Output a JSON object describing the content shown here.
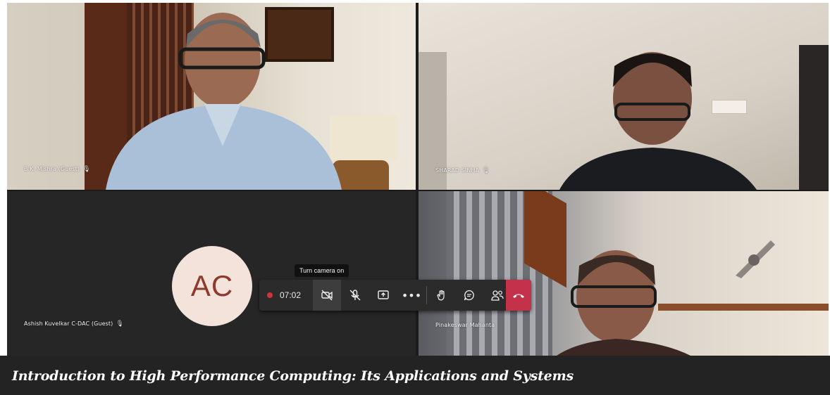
{
  "participants": [
    {
      "name": "B.K. Mishra (Guest)"
    },
    {
      "name": "SHARAD SINHA"
    },
    {
      "name": "Ashish Kuvelkar C-DAC (Guest)",
      "initials": "AC"
    },
    {
      "name": "Pinakeswar Mahanta"
    }
  ],
  "toolbar": {
    "timer": "07:02",
    "tooltip": "Turn camera on",
    "recording_color": "#d13438",
    "hangup_color": "#c4314b",
    "icons": [
      "record-icon",
      "camera-off-icon",
      "mic-off-icon",
      "share-screen-icon",
      "more-icon",
      "raise-hand-icon",
      "chat-icon",
      "people-icon",
      "hang-up-icon"
    ]
  },
  "caption": "Introduction to High Performance Computing: Its Applications and Systems"
}
